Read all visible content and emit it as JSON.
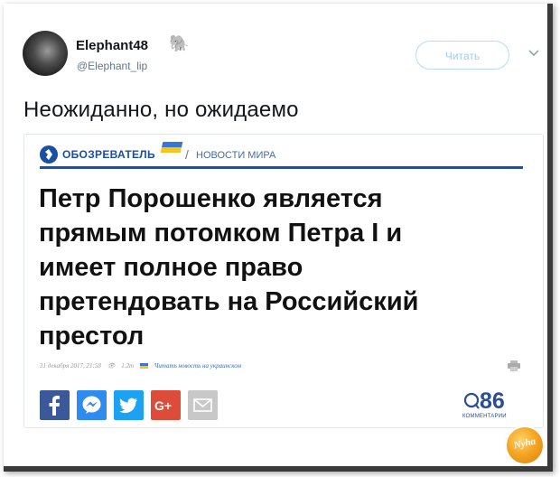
{
  "tweet": {
    "author": {
      "display_name": "Elephant48",
      "handle": "@Elephant_lip",
      "name_icon": "elephant-icon"
    },
    "follow_label": "Читать",
    "text": "Неожиданно, но ожидаемо"
  },
  "card": {
    "site_logo": "ОБОЗРЕВАТЕЛЬ",
    "section_label": "НОВОСТИ МИРА",
    "headline_lines": [
      "Петр Порошенко является",
      "прямым потомком Петра I и",
      "имеет полное право",
      "претендовать на Российский",
      "престол"
    ],
    "meta": {
      "date": "31 декабря 2017, 21:58",
      "views": "1.2т",
      "ukrainian_link": "Читать новость на украинском"
    },
    "share_buttons": [
      "facebook-icon",
      "messenger-icon",
      "twitter-icon",
      "google-plus-icon",
      "mail-icon"
    ],
    "comments": {
      "count": "86",
      "label": "КОММЕНТАРИИ"
    }
  },
  "watermark": {
    "text": "Nyha"
  },
  "colors": {
    "accent_blue": "#2a4d93",
    "follow_border": "#b9dbf5",
    "facebook": "#3b5998",
    "messenger": "#2e8bf0",
    "twitter": "#1da1f2",
    "google_plus": "#dd4b39",
    "mail": "#c8c8c8",
    "watermark": "#f5a623"
  }
}
